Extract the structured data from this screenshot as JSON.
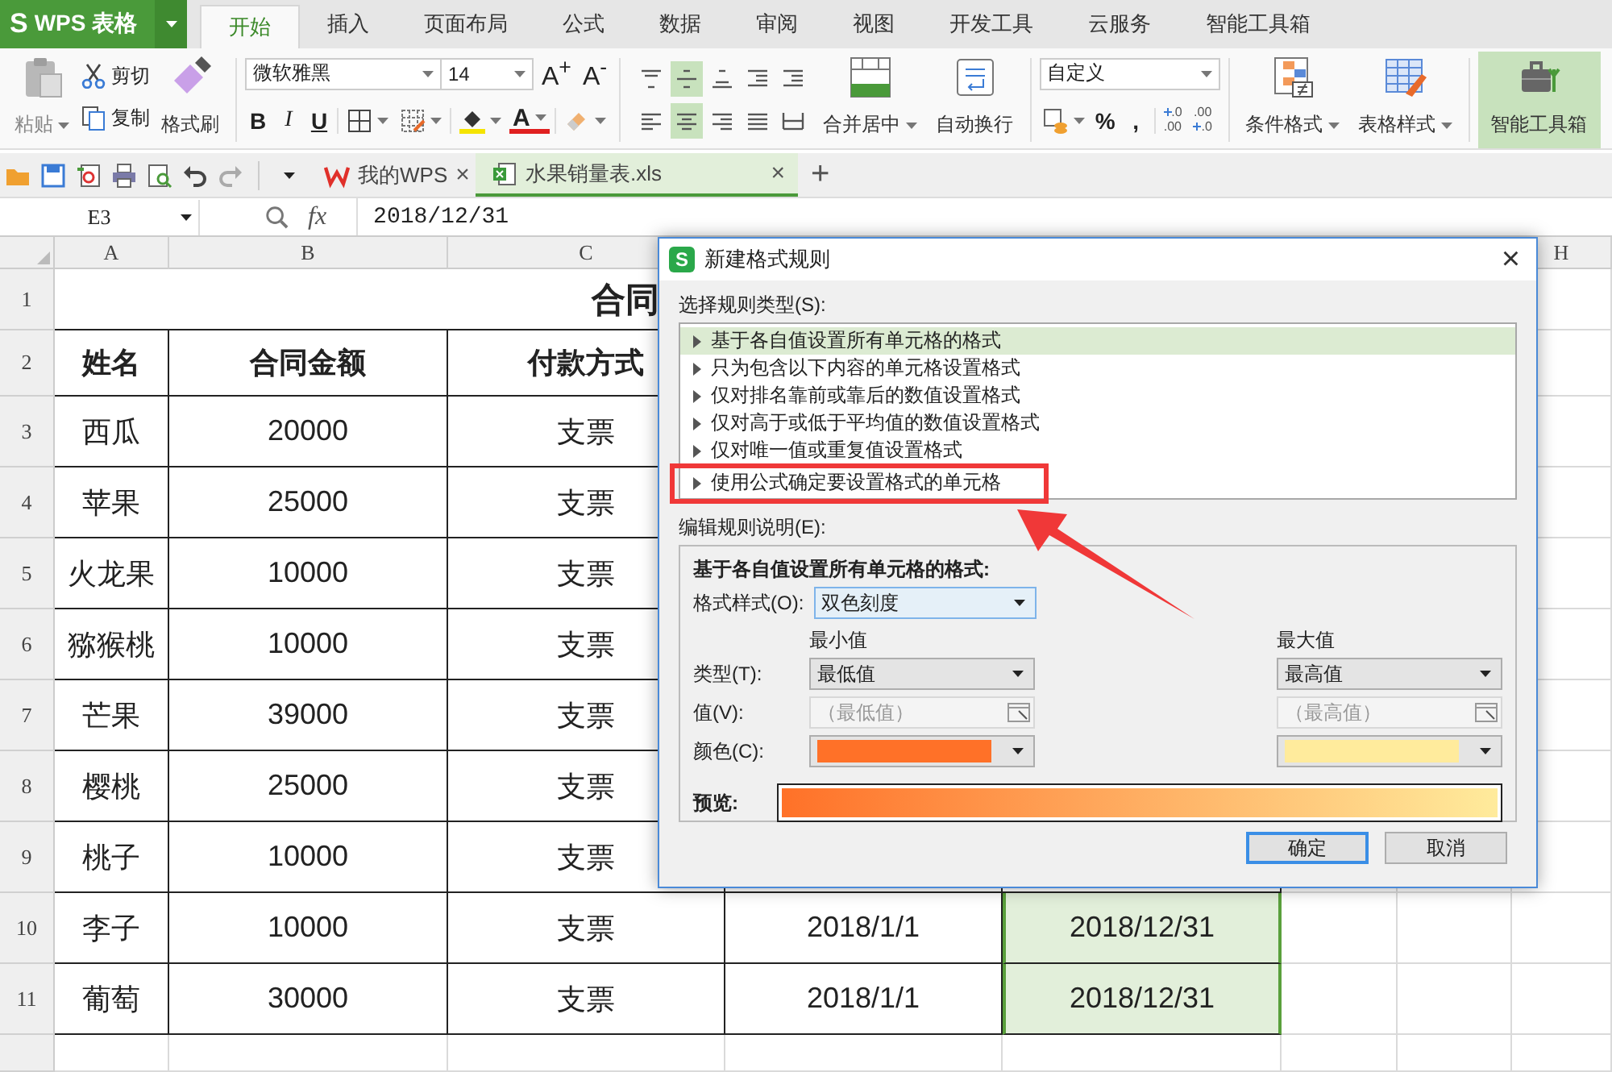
{
  "app": {
    "logo": "S",
    "name": "WPS 表格"
  },
  "tabs": [
    {
      "label": "开始",
      "selected": true
    },
    {
      "label": "插入",
      "selected": false
    },
    {
      "label": "页面布局",
      "selected": false
    },
    {
      "label": "公式",
      "selected": false
    },
    {
      "label": "数据",
      "selected": false
    },
    {
      "label": "审阅",
      "selected": false
    },
    {
      "label": "视图",
      "selected": false
    },
    {
      "label": "开发工具",
      "selected": false
    },
    {
      "label": "云服务",
      "selected": false
    },
    {
      "label": "智能工具箱",
      "selected": false
    }
  ],
  "ribbon": {
    "paste": {
      "label": "粘贴",
      "disabled": true
    },
    "cut": "剪切",
    "copy": "复制",
    "format_painter": "格式刷",
    "font_family": "微软雅黑",
    "font_size": "14",
    "size_buttons": [
      "A$^{+}$",
      "A$^{-}$"
    ],
    "style_buttons": [
      "B",
      "I",
      "U"
    ],
    "font_color": "A",
    "align_buttons": [
      {
        "kind": "top",
        "selected": false
      },
      {
        "kind": "middle",
        "selected": true
      },
      {
        "kind": "bottom",
        "selected": false
      },
      {
        "kind": "indent-dec",
        "selected": false
      },
      {
        "kind": "indent-inc",
        "selected": false
      },
      {
        "kind": "left",
        "selected": false
      },
      {
        "kind": "center",
        "selected": true
      },
      {
        "kind": "right",
        "selected": false
      },
      {
        "kind": "justify",
        "selected": false
      },
      {
        "kind": "distributed",
        "selected": false
      }
    ],
    "merge": "合并居中",
    "wrap": "自动换行",
    "number_format": "自定义",
    "number_buttons": [
      "%",
      ","
    ],
    "decimal_buttons": [
      {
        "kind": "increase",
        "top": ".0",
        "bottom": ".00"
      },
      {
        "kind": "decrease",
        "top": ".00",
        "bottom": ".0"
      }
    ],
    "conditional_format": "条件格式",
    "table_style": "表格样式",
    "toolbox": {
      "label": "智能工具箱",
      "selected": true
    }
  },
  "doc_tabs": [
    {
      "kind": "home",
      "label": "我的WPS",
      "selected": false,
      "close": "×"
    },
    {
      "kind": "sheet",
      "label": "水果销量表.xls",
      "selected": true,
      "close": "×"
    }
  ],
  "new_tab": "+",
  "formula_bar": {
    "cell": "E3",
    "fx": "fx",
    "value": "2018/12/31"
  },
  "sheet": {
    "column_headers": [
      "A",
      "B",
      "C",
      "H"
    ],
    "row_numbers": [
      "1",
      "2",
      "3",
      "4",
      "5",
      "6",
      "7",
      "8",
      "9",
      "10",
      "11"
    ],
    "title": "合同",
    "headers": [
      "姓名",
      "合同金额",
      "付款方式"
    ],
    "rows": [
      {
        "name": "西瓜",
        "amount": "20000",
        "payment": "支票"
      },
      {
        "name": "苹果",
        "amount": "25000",
        "payment": "支票"
      },
      {
        "name": "火龙果",
        "amount": "10000",
        "payment": "支票"
      },
      {
        "name": "猕猴桃",
        "amount": "10000",
        "payment": "支票"
      },
      {
        "name": "芒果",
        "amount": "39000",
        "payment": "支票"
      },
      {
        "name": "樱桃",
        "amount": "25000",
        "payment": "支票"
      },
      {
        "name": "桃子",
        "amount": "10000",
        "payment": "支票"
      },
      {
        "name": "李子",
        "amount": "10000",
        "payment": "支票",
        "start": "2018/1/1",
        "end": "2018/12/31",
        "end_selected": true
      },
      {
        "name": "葡萄",
        "amount": "30000",
        "payment": "支票",
        "start": "2018/1/1",
        "end": "2018/12/31",
        "end_selected": true
      }
    ]
  },
  "dialog": {
    "app_icon": "S",
    "title": "新建格式规则",
    "close": "×",
    "rule_type_label": "选择规则类型(S):",
    "rule_types": [
      {
        "label": "基于各自值设置所有单元格的格式",
        "selected": true
      },
      {
        "label": "只为包含以下内容的单元格设置格式",
        "selected": false
      },
      {
        "label": "仅对排名靠前或靠后的数值设置格式",
        "selected": false
      },
      {
        "label": "仅对高于或低于平均值的数值设置格式",
        "selected": false
      },
      {
        "label": "仅对唯一值或重复值设置格式",
        "selected": false
      },
      {
        "label": "使用公式确定要设置格式的单元格",
        "selected": false
      }
    ],
    "description_label": "编辑规则说明(E):",
    "description_title": "基于各自值设置所有单元格的格式:",
    "style_label": "格式样式(O):",
    "style": "双色刻度",
    "min_heading": "最小值",
    "max_heading": "最大值",
    "type_label": "类型(T):",
    "value_label": "值(V):",
    "color_label": "颜色(C):",
    "min": {
      "type": "最低值",
      "value_placeholder": "（最低值）",
      "color": "#ff7128"
    },
    "max": {
      "type": "最高值",
      "value_placeholder": "（最高值）",
      "color": "#ffeb9c"
    },
    "preview_label": "预览:",
    "buttons": [
      {
        "label": "确定",
        "default": true
      },
      {
        "label": "取消",
        "default": false
      }
    ]
  }
}
